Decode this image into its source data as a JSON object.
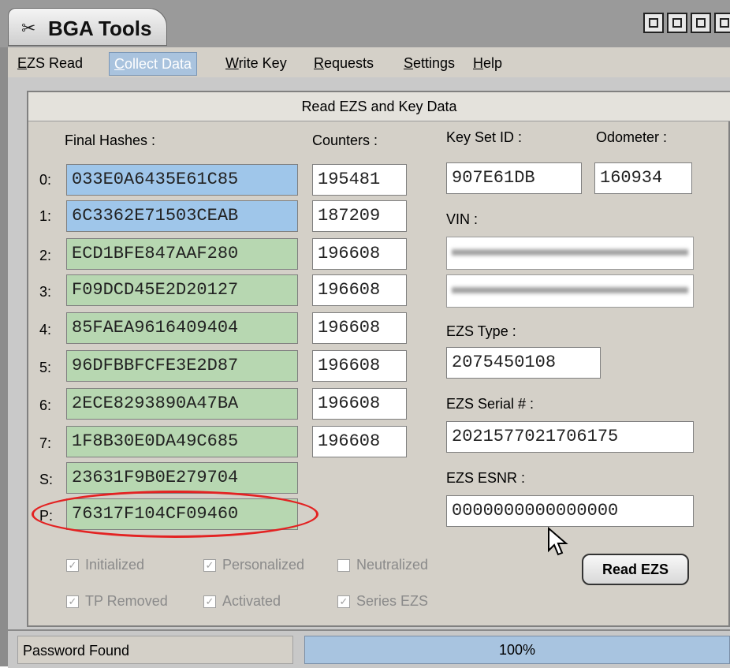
{
  "window": {
    "title": "BGA Tools",
    "app_icon": "bga-tools-icon"
  },
  "menu": {
    "items": [
      {
        "label": "EZS Read",
        "underline": "E",
        "rest": "ZS Read",
        "active": false
      },
      {
        "label": "Collect Data",
        "underline": "C",
        "rest": "ollect Data",
        "active": true
      },
      {
        "label": "Write Key",
        "underline": "W",
        "rest": "rite Key",
        "active": false
      },
      {
        "label": "Requests",
        "underline": "R",
        "rest": "equests",
        "active": false
      },
      {
        "label": "Settings",
        "underline": "S",
        "rest": "ettings",
        "active": false
      },
      {
        "label": "Help",
        "underline": "H",
        "rest": "elp",
        "active": false
      }
    ]
  },
  "panel": {
    "title": "Read EZS and Key Data",
    "hashes_label": "Final Hashes :",
    "counters_label": "Counters :",
    "keyset_label": "Key Set ID :",
    "odometer_label": "Odometer :",
    "vin_label": "VIN :",
    "ezs_type_label": "EZS Type :",
    "ezs_serial_label": "EZS Serial # :",
    "ezs_esnr_label": "EZS ESNR :",
    "keyset_value": "907E61DB",
    "odometer_value": "160934",
    "ezs_type_value": "2075450108",
    "ezs_serial_value": "2021577021706175",
    "ezs_esnr_value": "0000000000000000",
    "rows": [
      {
        "index": "0:",
        "hash": "033E0A6435E61C85",
        "counter": "195481"
      },
      {
        "index": "1:",
        "hash": "6C3362E71503CEAB",
        "counter": "187209"
      },
      {
        "index": "2:",
        "hash": "ECD1BFE847AAF280",
        "counter": "196608"
      },
      {
        "index": "3:",
        "hash": "F09DCD45E2D20127",
        "counter": "196608"
      },
      {
        "index": "4:",
        "hash": "85FAEA9616409404",
        "counter": "196608"
      },
      {
        "index": "5:",
        "hash": "96DFBBFCFE3E2D87",
        "counter": "196608"
      },
      {
        "index": "6:",
        "hash": "2ECE8293890A47BA",
        "counter": "196608"
      },
      {
        "index": "7:",
        "hash": "1F8B30E0DA49C685",
        "counter": "196608"
      },
      {
        "index": "S:",
        "hash": "23631F9B0E279704"
      },
      {
        "index": "P:",
        "hash": "76317F104CF09460"
      }
    ],
    "checkboxes": {
      "initialized": {
        "label": "Initialized",
        "checked": true
      },
      "personalized": {
        "label": "Personalized",
        "checked": true
      },
      "neutralized": {
        "label": "Neutralized",
        "checked": false
      },
      "tp_removed": {
        "label": "TP Removed",
        "checked": true
      },
      "activated": {
        "label": "Activated",
        "checked": true
      },
      "series_ezs": {
        "label": "Series EZS",
        "checked": true
      }
    },
    "read_button": "Read EZS"
  },
  "status": {
    "text": "Password Found",
    "progress": "100%"
  },
  "colors": {
    "hash_blue": "#9fc6ea",
    "hash_green": "#b7d7b1",
    "highlight": "#e32222",
    "progress": "#a8c4e0"
  }
}
